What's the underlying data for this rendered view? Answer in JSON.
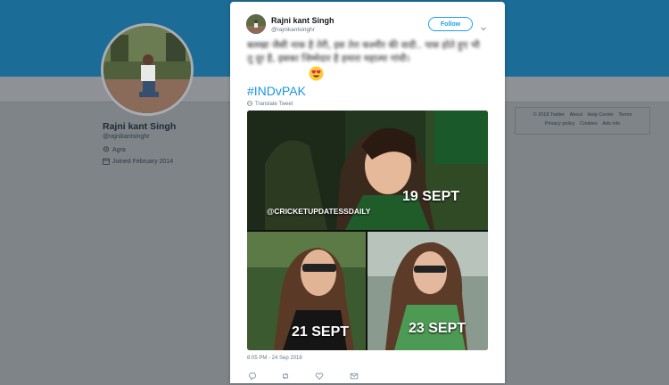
{
  "profile": {
    "name": "Rajni kant Singh",
    "handle": "@rajnikantsinghr",
    "location": "Agra",
    "joined": "Joined February 2014"
  },
  "footer_links": [
    "© 2018 Twitter",
    "About",
    "Help Center",
    "Terms",
    "Privacy policy",
    "Cookies",
    "Ads info"
  ],
  "tweet": {
    "author_name": "Rajni kant Singh",
    "author_handle": "@rajnikantsinghr",
    "follow_label": "Follow",
    "text": "बलखा जैसी नाक है तेरी, इस तेरा कश्मीर की वादी.. पास होते हुए भी तू दूर है, इसका जिम्मेदार है हमारा महात्मा गांधी।",
    "emoji": "heart-eyes-emoji",
    "hashtag": "#INDvPAK",
    "translate_label": "Translate Tweet",
    "timestamp": "8:05 PM - 24 Sep 2018"
  },
  "media": {
    "watermark": "@CRICKETUPDATESSDAILY",
    "dates": [
      "19 SEPT",
      "21 SEPT",
      "23 SEPT"
    ]
  },
  "colors": {
    "banner": "#1b6c97",
    "accent": "#1da1f2",
    "hashtag": "#1b95e0",
    "dim_overlay": "#7f8489"
  }
}
